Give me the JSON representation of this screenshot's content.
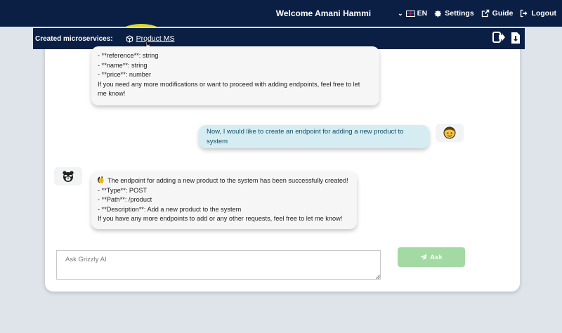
{
  "header": {
    "welcome": "Welcome Amani Hammi",
    "language": "EN",
    "settings": "Settings",
    "guide": "Guide",
    "logout": "Logout"
  },
  "microservices": {
    "label": "Created microservices:",
    "items": [
      {
        "label": "Product MS"
      }
    ]
  },
  "chat": {
    "messages": [
      {
        "role": "assistant",
        "lines": [
          "- **reference**: string",
          "- **name**: string",
          "- **price**: number",
          "If you need any more modifications or want to proceed with adding endpoints, feel free to let",
          "me know!"
        ]
      },
      {
        "role": "user",
        "text": "Now, I would like to create an endpoint for adding a new product to system"
      },
      {
        "role": "assistant",
        "lines": [
          "The endpoint for adding a new product to the system has been successfully created!",
          "- **Type**: POST",
          "- **Path**: /product",
          "- **Description**: Add a new product to the system",
          "If you have any more endpoints to add or any other requests, feel free to let me know!"
        ]
      }
    ]
  },
  "composer": {
    "placeholder": "Ask Grizzly AI",
    "button": "Ask"
  },
  "colors": {
    "nav": "#0b1f45",
    "user_bubble": "#d6ecf3",
    "ask_button": "#a3d9a3"
  }
}
